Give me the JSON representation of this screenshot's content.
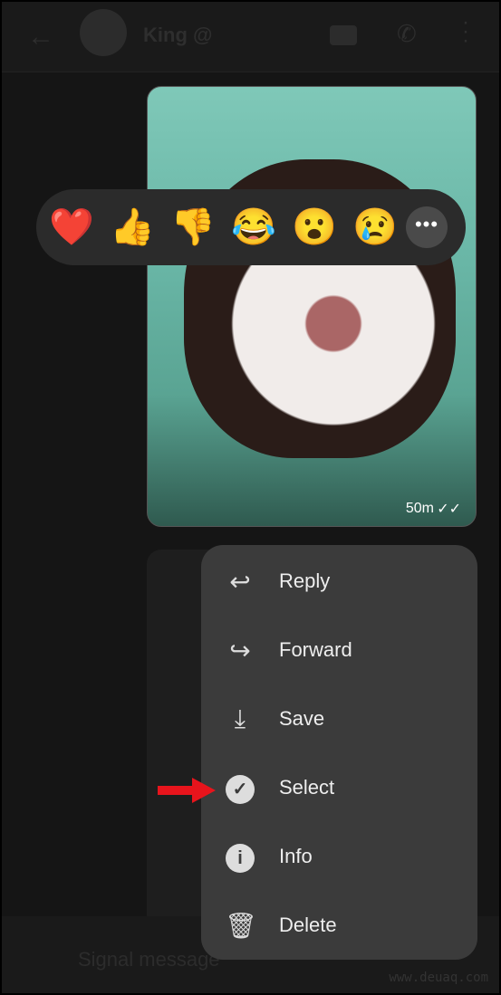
{
  "header": {
    "title": "King",
    "title_badge": "@",
    "back_icon": "arrow-left-icon",
    "video_icon": "video-icon",
    "call_icon": "phone-icon",
    "menu_icon": "more-vertical-icon"
  },
  "message": {
    "time": "50m",
    "status_icon": "double-check-icon"
  },
  "reactions": [
    "❤️",
    "👍",
    "👎",
    "😂",
    "😮",
    "😢"
  ],
  "reactions_more": "•••",
  "menu": {
    "items": [
      {
        "label": "Reply",
        "icon": "reply-icon",
        "glyph": "↩"
      },
      {
        "label": "Forward",
        "icon": "forward-icon",
        "glyph": "↪"
      },
      {
        "label": "Save",
        "icon": "save-icon",
        "glyph": "⤓"
      },
      {
        "label": "Select",
        "icon": "check-circle-icon",
        "glyph": "✓"
      },
      {
        "label": "Info",
        "icon": "info-icon",
        "glyph": "i"
      },
      {
        "label": "Delete",
        "icon": "trash-icon",
        "glyph": "🗑"
      }
    ]
  },
  "composer": {
    "placeholder": "Signal message"
  },
  "watermark": "www.deuaq.com",
  "colors": {
    "annotation_arrow": "#e8141c",
    "menu_bg": "#3b3b3b"
  }
}
